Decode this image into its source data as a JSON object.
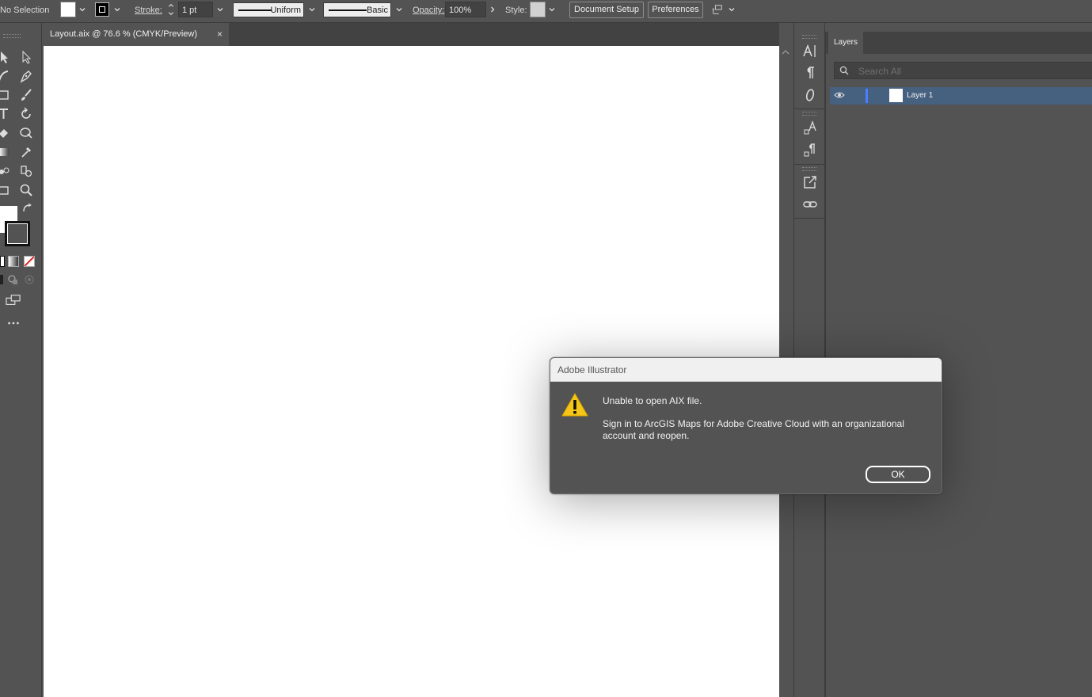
{
  "control_bar": {
    "selection_label": "No Selection",
    "stroke_label": "Stroke:",
    "stroke_weight": "1 pt",
    "stroke_profile": "Uniform",
    "brush_label": "Basic",
    "opacity_label": "Opacity:",
    "opacity_value": "100%",
    "style_label": "Style:",
    "document_setup": "Document Setup",
    "preferences": "Preferences"
  },
  "document": {
    "tab_title": "Layout.aix @ 76.6 % (CMYK/Preview)",
    "close_glyph": "×"
  },
  "layers_panel": {
    "tab_label": "Layers",
    "search_placeholder": "Search All",
    "layers": [
      {
        "name": "Layer 1",
        "visible": true,
        "color": "#4f7dff"
      }
    ]
  },
  "dialog": {
    "title": "Adobe Illustrator",
    "message": "Unable to open AIX file.",
    "detail": "Sign in to ArcGIS Maps for Adobe Creative Cloud with an organizational account and reopen.",
    "ok_label": "OK",
    "icon": "warning-icon"
  },
  "colors": {
    "ui_background": "#535353",
    "canvas": "#ffffff",
    "layer_selection": "#46607f",
    "warning": "#f5c518"
  }
}
